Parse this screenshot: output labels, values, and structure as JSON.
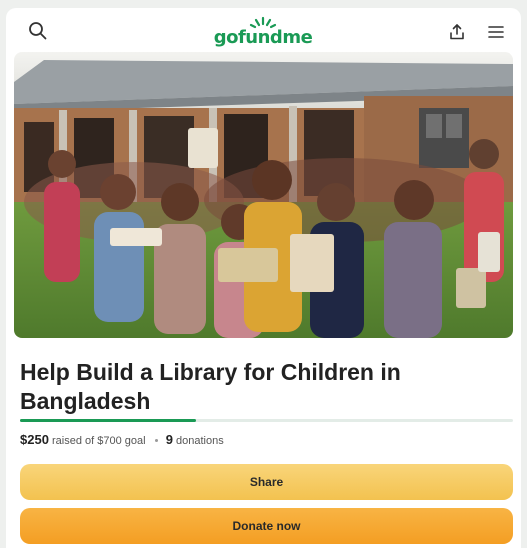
{
  "header": {
    "logo_text": "gofundme",
    "search_icon": "search-icon",
    "share_icon": "share-icon",
    "menu_icon": "menu-icon"
  },
  "hero": {
    "image_alt": "photo of smiling children holding books outside a school"
  },
  "campaign": {
    "title": "Help Build a Library for Children in Bangladesh",
    "raised": "$250",
    "raised_text": "raised of $700 goal",
    "donations_count": "9",
    "donations_label": "donations",
    "progress_fraction": 0.357
  },
  "actions": {
    "share_label": "Share",
    "donate_label": "Donate now"
  },
  "colors": {
    "brand_green": "#1a9a55",
    "share_yellow": "#f5c85a",
    "donate_orange": "#f6a530"
  }
}
